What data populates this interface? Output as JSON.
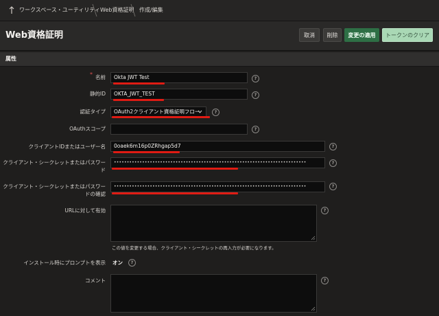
{
  "breadcrumb": {
    "items": [
      "ワークスペース・ユーティリティ",
      "Web資格証明",
      "作成/編集"
    ]
  },
  "header": {
    "title": "Web資格証明",
    "buttons": {
      "cancel": "取消",
      "delete": "削除",
      "apply": "変更の適用",
      "clear_token": "トークンのクリア"
    }
  },
  "section": {
    "title": "属性"
  },
  "form": {
    "name": {
      "label": "名前",
      "value": "Okta JWT Test"
    },
    "static_id": {
      "label": "静的ID",
      "value": "OKTA_JWT_TEST"
    },
    "auth_type": {
      "label": "認証タイプ",
      "value": "OAuth2クライアント資格証明フロー"
    },
    "oauth_scope": {
      "label": "OAuthスコープ",
      "value": ""
    },
    "client_id": {
      "label": "クライアントIDまたはユーザー名",
      "value": "0oaek6m16p0ZRhgap5d7"
    },
    "client_secret": {
      "label": "クライアント・シークレットまたはパスワード",
      "value": "•••••••••••••••••••••••••••••••••••••••••••••••••••••••••••••••••••••••••••"
    },
    "client_secret_confirm": {
      "label": "クライアント・シークレットまたはパスワードの確認",
      "value": "•••••••••••••••••••••••••••••••••••••••••••••••••••••••••••••••••••••••••••"
    },
    "valid_urls": {
      "label": "URLに対して有効",
      "note": "この値を変更する場合、クライアント・シークレットの再入力が必要になります。"
    },
    "prompt_on_install": {
      "label": "インストール時にプロンプトを表示",
      "value": "オン"
    },
    "comment": {
      "label": "コメント"
    }
  },
  "help_glyph": "?",
  "required_glyph": "*",
  "colors": {
    "accent_green": "#2e6f45",
    "light_green": "#a9d8b5",
    "highlight_red": "#e01b13",
    "background": "#1f1e1d"
  },
  "icons": [
    "up-arrow-icon",
    "chevron-down-icon",
    "help-icon",
    "resize-handle-icon"
  ]
}
